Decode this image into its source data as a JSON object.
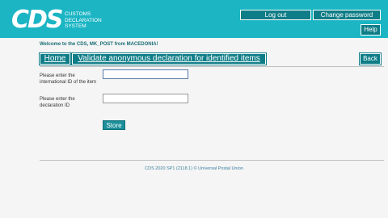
{
  "header": {
    "logo": "CDS",
    "logo_lines": [
      "CUSTOMS",
      "DECLARATION",
      "SYSTEM"
    ],
    "logout_label": "Log out",
    "change_password_label": "Change password",
    "help_label": "Help",
    "background_color": "#1bb5c4"
  },
  "welcome": "Welcome to the CDS, MK_POST from MACEDONIA!",
  "nav": {
    "home_label": "Home",
    "page_title": "Validate anonymous declaration for identified items",
    "back_label": "Back",
    "accent_color": "#0e7d87"
  },
  "form": {
    "field1_label": "Please enter the international ID of the item",
    "field1_value": "",
    "field2_label": "Please enter the declaration ID",
    "field2_value": "",
    "store_label": "Store"
  },
  "footer": {
    "text": "CDS 2020 SP1 (2118.1) © Universal Postal Union"
  }
}
